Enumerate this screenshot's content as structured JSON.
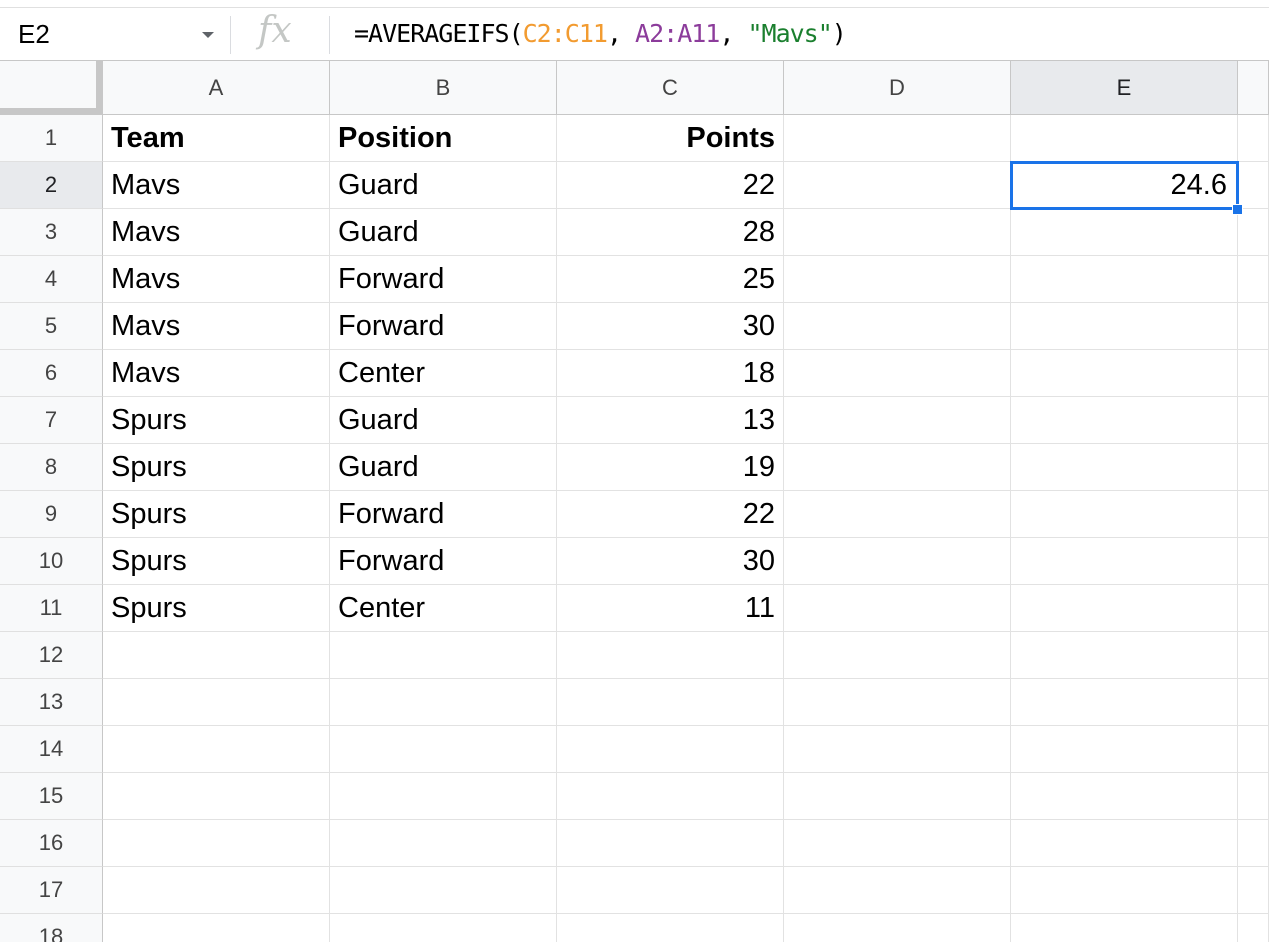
{
  "name_box": "E2",
  "fx_label": "fx",
  "formula_parts": [
    "=AVERAGEIFS(",
    "C2:C11",
    ", ",
    "A2:A11",
    ", ",
    "\"Mavs\"",
    ")"
  ],
  "columns": [
    "A",
    "B",
    "C",
    "D",
    "E"
  ],
  "rows": [
    "1",
    "2",
    "3",
    "4",
    "5",
    "6",
    "7",
    "8",
    "9",
    "10",
    "11",
    "12",
    "13",
    "14",
    "15",
    "16",
    "17",
    "18"
  ],
  "table": {
    "headers": [
      "Team",
      "Position",
      "Points"
    ],
    "data": [
      [
        "Mavs",
        "Guard",
        "22"
      ],
      [
        "Mavs",
        "Guard",
        "28"
      ],
      [
        "Mavs",
        "Forward",
        "25"
      ],
      [
        "Mavs",
        "Forward",
        "30"
      ],
      [
        "Mavs",
        "Center",
        "18"
      ],
      [
        "Spurs",
        "Guard",
        "13"
      ],
      [
        "Spurs",
        "Guard",
        "19"
      ],
      [
        "Spurs",
        "Forward",
        "22"
      ],
      [
        "Spurs",
        "Forward",
        "30"
      ],
      [
        "Spurs",
        "Center",
        "11"
      ]
    ]
  },
  "result_cell": {
    "ref": "E2",
    "value": "24.6"
  },
  "selection_color": "#1a73e8",
  "icons": {
    "name_box_dropdown": "caret-down-icon",
    "formula": "fx-icon"
  }
}
